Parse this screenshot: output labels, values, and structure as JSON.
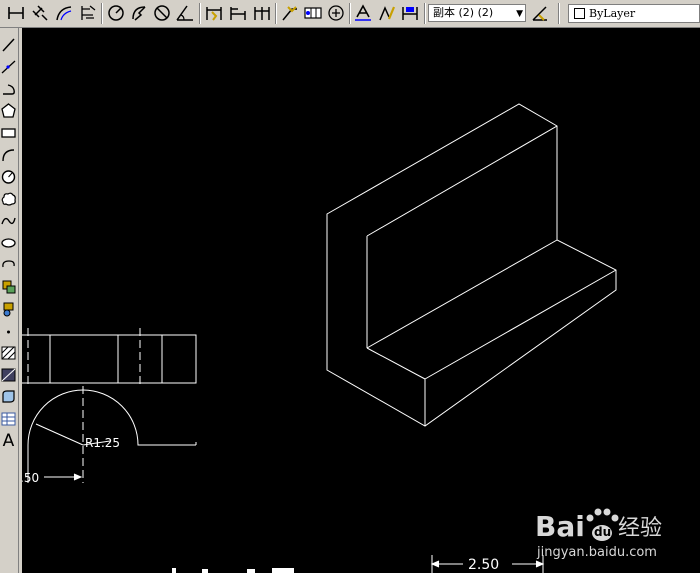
{
  "toolbar": {
    "buttons": [
      {
        "name": "linear-dimension-icon"
      },
      {
        "name": "aligned-dimension-icon"
      },
      {
        "name": "arc-length-dimension-icon"
      },
      {
        "name": "ordinate-dimension-icon"
      },
      {
        "name": "radius-dimension-icon"
      },
      {
        "name": "jogged-dimension-icon"
      },
      {
        "name": "diameter-dimension-icon"
      },
      {
        "name": "angular-dimension-icon"
      },
      {
        "name": "quick-dimension-icon"
      },
      {
        "name": "baseline-dimension-icon"
      },
      {
        "name": "continue-dimension-icon"
      },
      {
        "name": "quick-leader-icon"
      },
      {
        "name": "tolerance-icon"
      },
      {
        "name": "center-mark-icon"
      },
      {
        "name": "dimension-edit-icon"
      },
      {
        "name": "dimension-text-edit-icon"
      },
      {
        "name": "dimension-update-icon"
      },
      {
        "name": "dimension-style-icon"
      }
    ],
    "dim_style_value": "副本 (2) (2)",
    "layer_value": "ByLayer"
  },
  "left_toolbar": {
    "tools": [
      "line-icon",
      "construction-line-icon",
      "polyline-icon",
      "polygon-icon",
      "rectangle-icon",
      "arc-icon",
      "circle-icon",
      "revision-cloud-icon",
      "spline-icon",
      "ellipse-icon",
      "ellipse-arc-icon",
      "insert-block-icon",
      "make-block-icon",
      "point-icon",
      "hatch-icon",
      "gradient-icon",
      "region-icon",
      "table-icon",
      "multiline-text-icon"
    ],
    "text_tool_label": "A"
  },
  "drawing": {
    "radius_label": "R1.25",
    "left_dim_label": ".50",
    "bottom_dim_label": "2.50"
  },
  "watermark": {
    "brand": "Bai",
    "brand2": "du",
    "brand_cn": "经验",
    "url": "jingyan.baidu.com"
  },
  "colors": {
    "canvas": "#000000",
    "lines": "#ffffff",
    "watermark": "#d8d8d8"
  }
}
